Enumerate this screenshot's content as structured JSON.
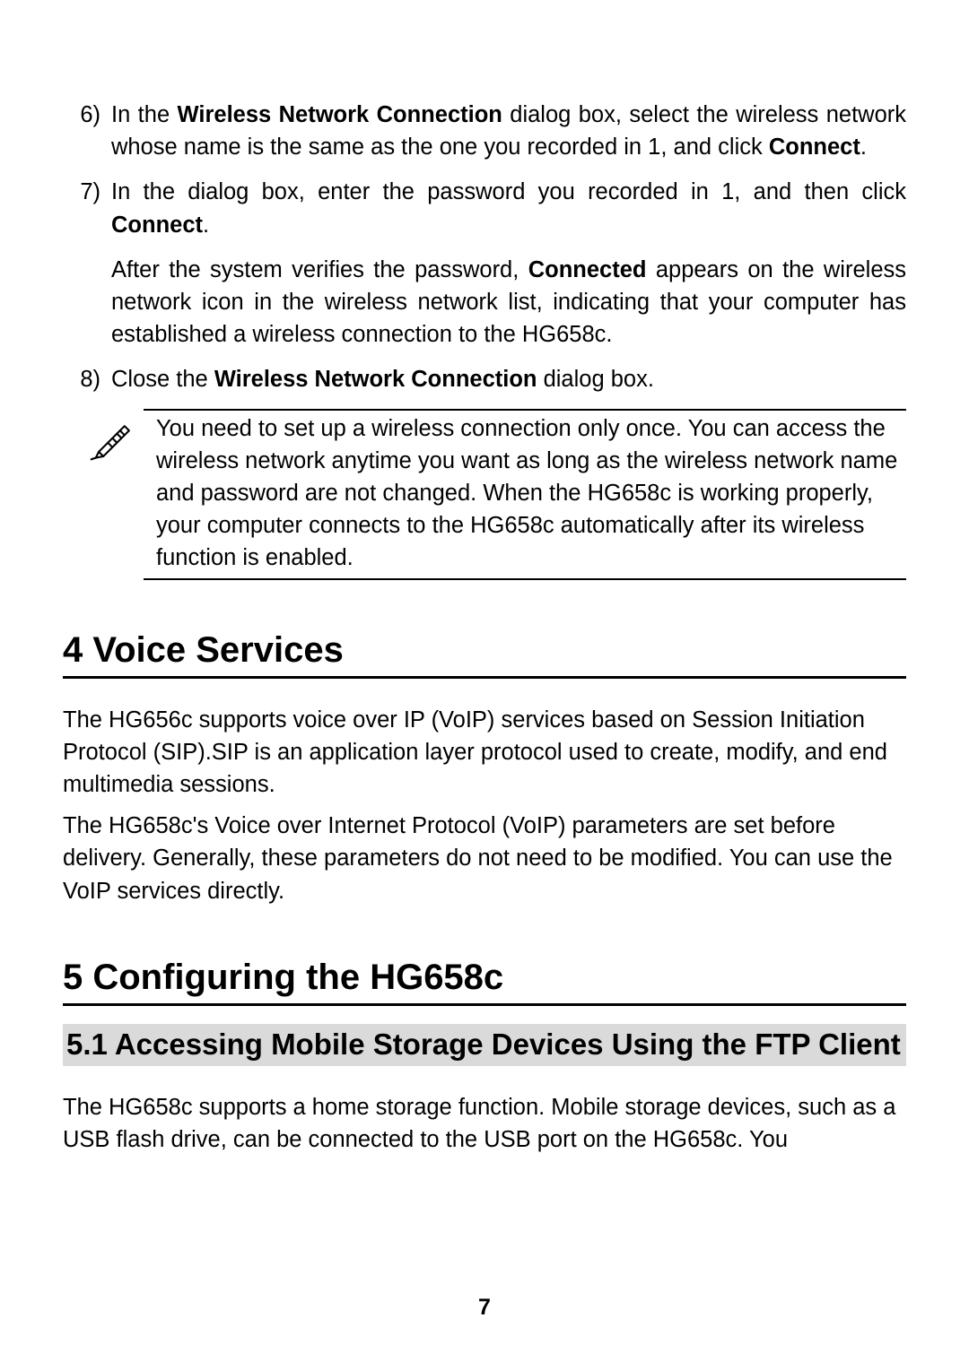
{
  "steps": [
    {
      "marker": "6)",
      "paragraphs": [
        {
          "runs": [
            {
              "t": "In the "
            },
            {
              "t": "Wireless Network Connection",
              "b": true
            },
            {
              "t": " dialog box, select the wireless network whose name is the same as the one you recorded in 1, and click "
            },
            {
              "t": "Connect",
              "b": true
            },
            {
              "t": "."
            }
          ]
        }
      ]
    },
    {
      "marker": "7)",
      "paragraphs": [
        {
          "runs": [
            {
              "t": "In the dialog box, enter the password you recorded in 1, and then click "
            },
            {
              "t": "Connect",
              "b": true
            },
            {
              "t": "."
            }
          ]
        },
        {
          "runs": [
            {
              "t": "After the system verifies the password, "
            },
            {
              "t": "Connected",
              "b": true
            },
            {
              "t": " appears on the wireless network icon in the wireless network list, indicating that your computer has established a wireless connection to the HG658c."
            }
          ]
        }
      ]
    },
    {
      "marker": "8)",
      "paragraphs": [
        {
          "runs": [
            {
              "t": "Close the "
            },
            {
              "t": "Wireless Network Connection",
              "b": true
            },
            {
              "t": " dialog box."
            }
          ]
        }
      ]
    }
  ],
  "note": "You need to set up a wireless connection only once. You can access the wireless network anytime you want as long as the wireless network name and password are not changed. When the HG658c is working properly, your computer connects to the HG658c automatically after its wireless function is enabled.",
  "section4_title": "4 Voice Services",
  "section4_p1": "The HG656c supports voice over IP (VoIP) services based on Session Initiation Protocol (SIP).SIP is an application layer protocol used to create, modify, and end multimedia sessions.",
  "section4_p2": "The HG658c's Voice over Internet Protocol (VoIP) parameters are set before delivery. Generally, these parameters do not need to be modified. You can use the VoIP services directly.",
  "section5_title": "5 Configuring the HG658c",
  "section5_1_title": "5.1 Accessing Mobile Storage Devices Using the FTP Client",
  "section5_1_p1": "The HG658c supports a home storage function. Mobile storage devices, such as a USB flash drive, can be connected to the USB port on the HG658c. You",
  "page_number": "7"
}
